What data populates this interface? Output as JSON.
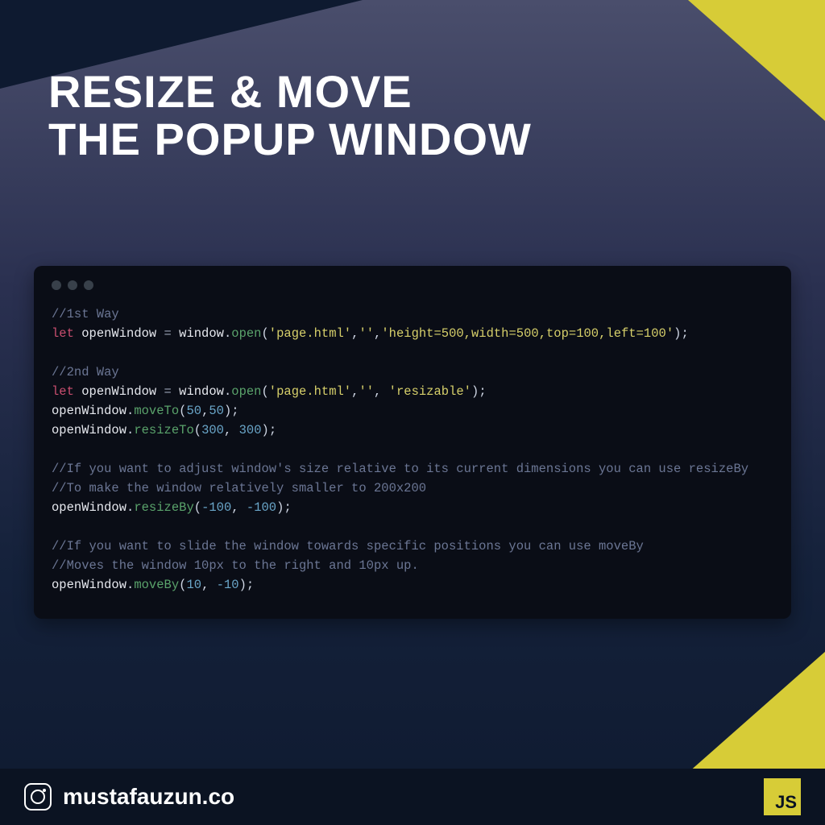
{
  "title_line1": "RESIZE & MOVE",
  "title_line2": "THE POPUP WINDOW",
  "code": {
    "c1": "//1st Way",
    "kw": "let",
    "var": "openWindow",
    "eq": " = ",
    "win": "window",
    "dot": ".",
    "open": "open",
    "lp": "(",
    "rp": ")",
    "sc": ";",
    "comma": ",",
    "arg_page": "'page.html'",
    "arg_empty": "''",
    "arg_spec": "'height=500,width=500,top=100,left=100'",
    "c2": "//2nd Way",
    "arg_resizable": "'resizable'",
    "moveTo": "moveTo",
    "n50a": "50",
    "n50b": "50",
    "resizeTo": "resizeTo",
    "n300a": "300",
    "n300b": "300",
    "c3": "//If you want to adjust window's size relative to its current dimensions you can use resizeBy",
    "c4": "//To make the window relatively smaller to 200x200",
    "resizeBy": "resizeBy",
    "nm100a": "-100",
    "nm100b": "-100",
    "c5": "//If you want to slide the window towards specific positions you can use moveBy",
    "c6": "//Moves the window 10px to the right and 10px up.",
    "moveBy": "moveBy",
    "n10": "10",
    "nm10": "-10",
    "sp": " "
  },
  "footer": {
    "handle": "mustafauzun.co",
    "badge": "JS"
  }
}
